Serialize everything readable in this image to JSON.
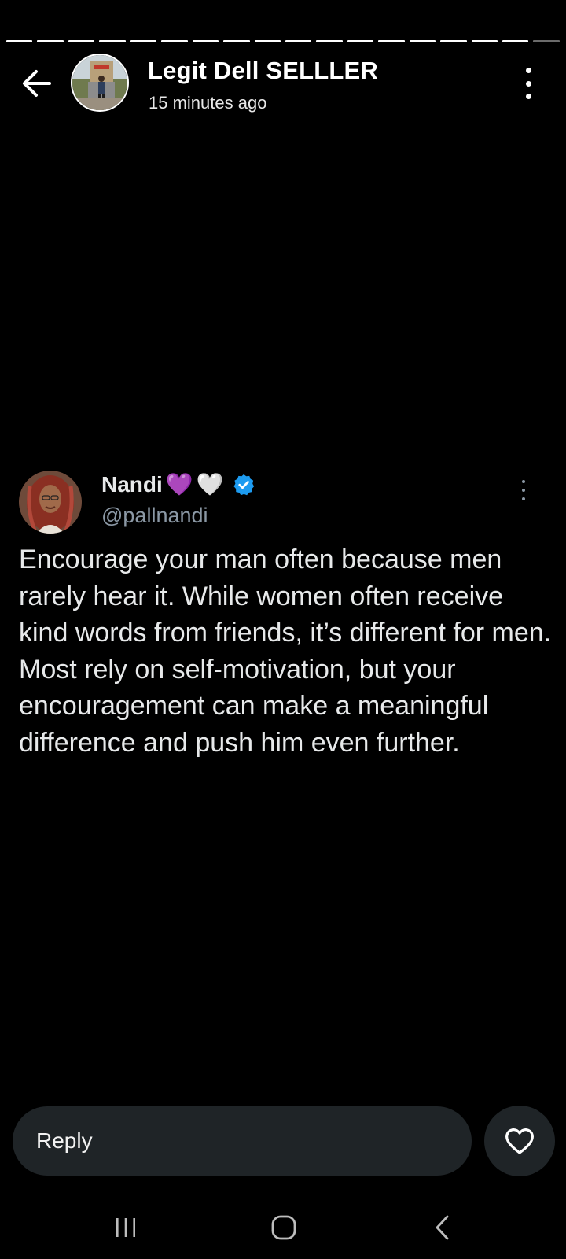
{
  "story": {
    "segments_total": 18,
    "segments_viewed": 17
  },
  "header": {
    "poster_name": "Legit Dell SELLLER",
    "posted_time": "15 minutes ago"
  },
  "tweet": {
    "author_name": "Nandi",
    "emoji_1": "💜",
    "emoji_2": "🤍",
    "handle": "@pallnandi",
    "verified": true,
    "text": "Encourage your man often because men rarely hear it. While women often receive kind words from friends, it’s different for men. Most rely on self-motivation, but your encouragement can make a meaningful difference and push him even further."
  },
  "reply": {
    "placeholder": "Reply"
  },
  "icons": {
    "back": "arrow-left-icon",
    "more": "more-vertical-icon",
    "verified": "verified-badge-icon",
    "like": "heart-icon",
    "nav_recents": "recents-icon",
    "nav_home": "home-icon",
    "nav_back": "chevron-left-icon"
  },
  "colors": {
    "background": "#000000",
    "verified_blue": "#1d9bf0",
    "handle_gray": "#8b98a5",
    "reply_bar": "#1f2427"
  }
}
